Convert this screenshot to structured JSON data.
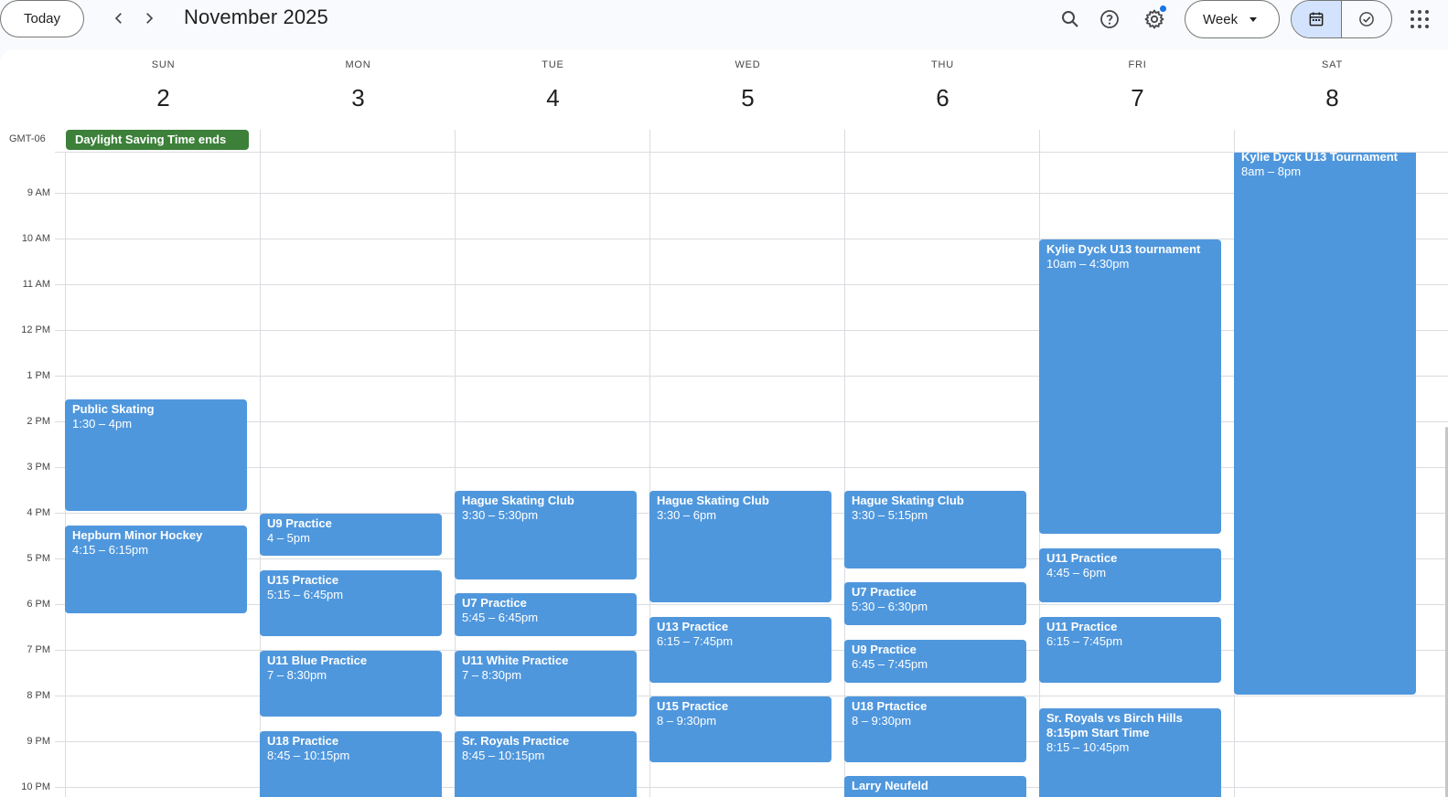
{
  "header": {
    "today_label": "Today",
    "month_title": "November 2025",
    "view_label": "Week"
  },
  "timezone": "GMT-06",
  "days": [
    {
      "dow": "SUN",
      "num": "2"
    },
    {
      "dow": "MON",
      "num": "3"
    },
    {
      "dow": "TUE",
      "num": "4"
    },
    {
      "dow": "WED",
      "num": "5"
    },
    {
      "dow": "THU",
      "num": "6"
    },
    {
      "dow": "FRI",
      "num": "7"
    },
    {
      "dow": "SAT",
      "num": "8"
    }
  ],
  "allday_event": "Daylight Saving Time ends",
  "hours": [
    "9 AM",
    "10 AM",
    "11 AM",
    "12 PM",
    "1 PM",
    "2 PM",
    "3 PM",
    "4 PM",
    "5 PM",
    "6 PM",
    "7 PM",
    "8 PM",
    "9 PM",
    "10 PM"
  ],
  "events": [
    {
      "title": "Public Skating",
      "time": "1:30 – 4pm"
    },
    {
      "title": "Hepburn Minor Hockey",
      "time": "4:15 – 6:15pm"
    },
    {
      "title": "U9 Practice",
      "time": "4 – 5pm"
    },
    {
      "title": "U15 Practice",
      "time": "5:15 – 6:45pm"
    },
    {
      "title": "U11 Blue Practice",
      "time": "7 – 8:30pm"
    },
    {
      "title": "U18 Practice",
      "time": "8:45 – 10:15pm"
    },
    {
      "title": "Hague Skating Club",
      "time": "3:30 – 5:30pm"
    },
    {
      "title": "U7 Practice",
      "time": "5:45 – 6:45pm"
    },
    {
      "title": "U11 White Practice",
      "time": "7 – 8:30pm"
    },
    {
      "title": "Sr. Royals Practice",
      "time": "8:45 – 10:15pm"
    },
    {
      "title": "Hague Skating Club",
      "time": "3:30 – 6pm"
    },
    {
      "title": "U13 Practice",
      "time": "6:15 – 7:45pm"
    },
    {
      "title": "U15 Practice",
      "time": "8 – 9:30pm"
    },
    {
      "title": "Hague Skating Club",
      "time": "3:30 – 5:15pm"
    },
    {
      "title": "U7 Practice",
      "time": "5:30 – 6:30pm"
    },
    {
      "title": "U9 Practice",
      "time": "6:45 – 7:45pm"
    },
    {
      "title": "U18 Prtactice",
      "time": "8 – 9:30pm"
    },
    {
      "title": "Larry Neufeld",
      "time": ""
    },
    {
      "title": "Kylie Dyck U13 tournament",
      "time": "10am – 4:30pm"
    },
    {
      "title": "U11 Practice",
      "time": "4:45 – 6pm"
    },
    {
      "title": "U11 Practice",
      "time": "6:15 – 7:45pm"
    },
    {
      "title": "Sr. Royals vs Birch Hills 8:15pm Start Time",
      "time": "8:15 – 10:45pm"
    },
    {
      "title": "Kylie Dyck U13 Tournament",
      "time": "8am – 8pm"
    }
  ],
  "colors": {
    "event": "#4f97dd",
    "allday": "#3c8039",
    "accent": "#1a73e8"
  }
}
